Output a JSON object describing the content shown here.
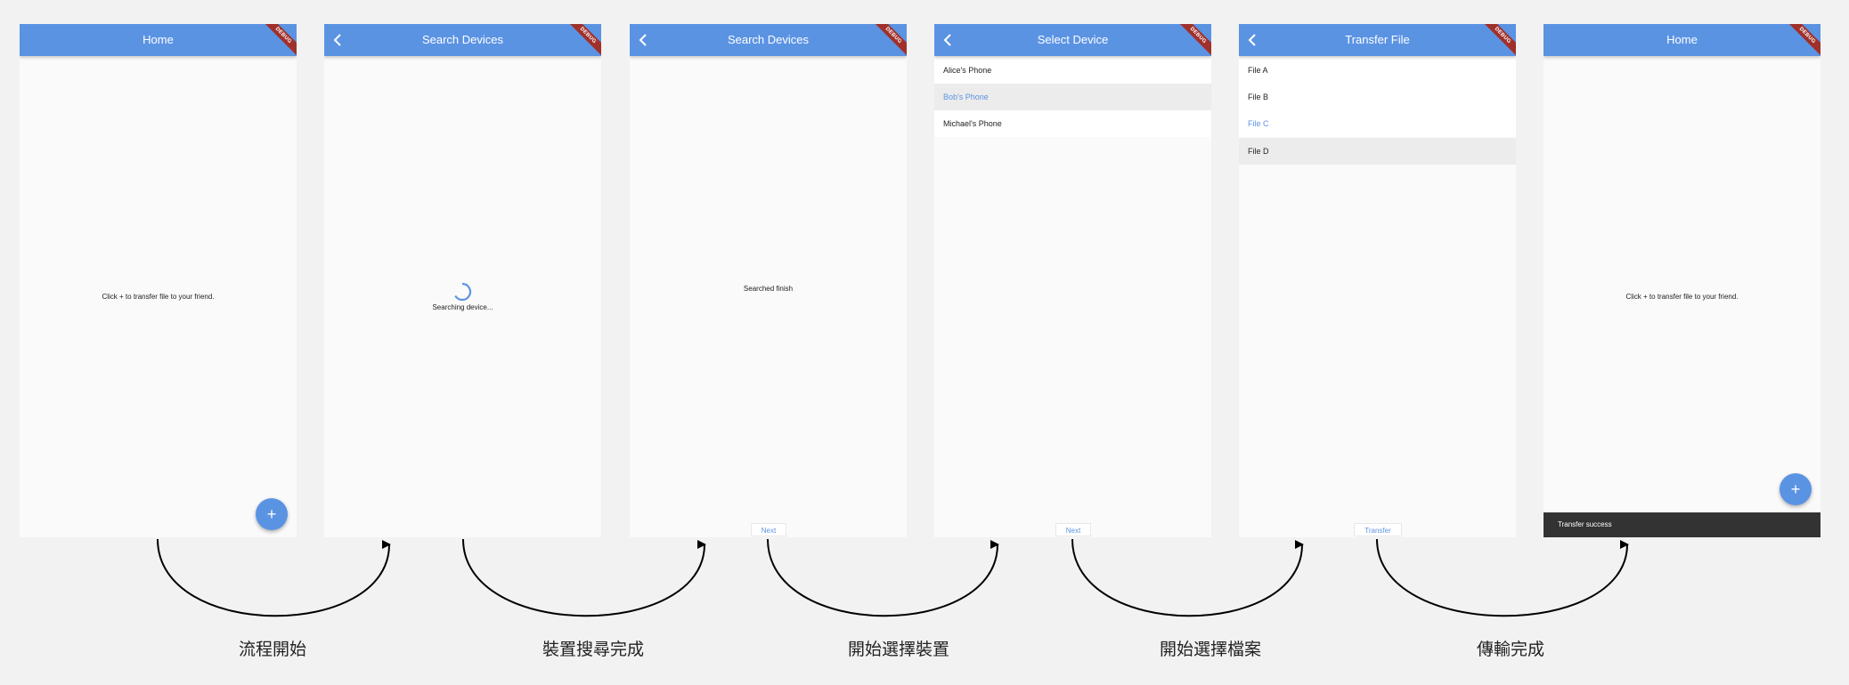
{
  "debug_label": "DEBUG",
  "screens": [
    {
      "title": "Home",
      "message": "Click + to transfer file to your friend.",
      "fab": "+"
    },
    {
      "title": "Search Devices",
      "message": "Searching device..."
    },
    {
      "title": "Search Devices",
      "message": "Searched finish",
      "button": "Next"
    },
    {
      "title": "Select Device",
      "items": [
        "Alice's Phone",
        "Bob's Phone",
        "Michael's Phone"
      ],
      "button": "Next"
    },
    {
      "title": "Transfer File",
      "items": [
        "File A",
        "File B",
        "File C",
        "File D"
      ],
      "button": "Transfer"
    },
    {
      "title": "Home",
      "message": "Click + to transfer file to your friend.",
      "fab": "+",
      "snackbar": "Transfer success"
    }
  ],
  "captions": [
    "流程開始",
    "裝置搜尋完成",
    "開始選擇裝置",
    "開始選擇檔案",
    "傳輸完成"
  ],
  "colors": {
    "appbar": "#5b93e3",
    "background": "#f2f2f2",
    "debug_banner": "#a0302a",
    "snackbar": "#333333"
  },
  "icons": [
    "back-arrow-icon",
    "add-icon",
    "loading-spinner-icon",
    "flow-arrow-icon"
  ]
}
